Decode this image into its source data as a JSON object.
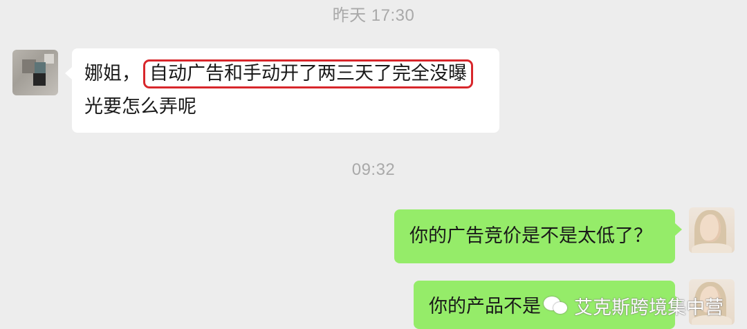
{
  "chat": {
    "timestamps": [
      "昨天 17:30",
      "09:32"
    ],
    "messages": [
      {
        "sender": "other",
        "prefix": "娜姐，",
        "highlighted": "自动广告和手动开了两三天了完全没曝",
        "continuation": "光要怎么弄呢"
      },
      {
        "sender": "self",
        "text": "你的广告竞价是不是太低了？"
      },
      {
        "sender": "self",
        "text": "你的产品不是"
      }
    ]
  },
  "watermark": {
    "icon": "wechat-icon",
    "text": "艾克斯跨境集中营"
  },
  "colors": {
    "background": "#ededed",
    "incoming_bubble": "#ffffff",
    "outgoing_bubble": "#95ec69",
    "highlight_border": "#d8262b",
    "timestamp_text": "#a9a9a9"
  }
}
